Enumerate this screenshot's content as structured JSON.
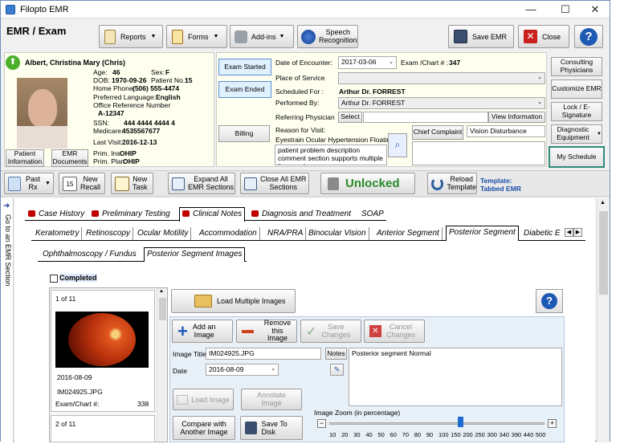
{
  "window": {
    "title": "Filopto EMR",
    "minimize": "—",
    "maximize": "☐",
    "close": "✕"
  },
  "header": {
    "title": "EMR / Exam"
  },
  "toolbar": {
    "reports": "Reports",
    "forms": "Forms",
    "addins": "Add-ins",
    "speech1": "Speech",
    "speech2": "Recognition",
    "save": "Save EMR",
    "close": "Close",
    "help": "?"
  },
  "patient": {
    "name": "Albert, Christina Mary (Chris)",
    "age_l": "Age:",
    "age": "46",
    "sex_l": "Sex:",
    "sex": "F",
    "dob_l": "DOB:",
    "dob": "1970-09-26",
    "pno_l": "Patient No.:",
    "pno": "15",
    "home_l": "Home Phone:",
    "home": "(506) 555-4474",
    "lang_l": "Preferred Language:",
    "lang": "English",
    "ref_l": "Office Reference Number",
    "ref": "A-12347",
    "ssn_l": "SSN:",
    "ssn": "444 4444 4444 4",
    "med_l": "Medicare:",
    "med": "4535567677",
    "last_l": "Last Visit:",
    "last": "2016-12-13",
    "pins_l": "Prim. Ins:",
    "pins": "OHIP",
    "pplan_l": "Prim. Plan:",
    "pplan": "OHIP",
    "info_btn": "Patient Information",
    "docs_btn": "EMR Documents"
  },
  "exam": {
    "started": "Exam Started",
    "ended": "Exam Ended",
    "billing": "Billing",
    "date_l": "Date of Encounter:",
    "date": "2017-03-06",
    "chart_l": "Exam /Chart # :",
    "chart": "347",
    "place_l": "Place of Service",
    "sched_l": "Scheduled For :",
    "sched": "Arthur Dr. FORREST",
    "perf_l": "Performed By:",
    "perf": "Arthur  Dr. FORREST",
    "refphys_l": "Referring Physician",
    "select": "Select",
    "viewinfo": "View Information",
    "reason_l": "Reason for Visit:",
    "reason": "Eyestrain Ocular Hypertension Floatin",
    "chief_btn": "Chief Complaint",
    "chief": "Vision Disturbance",
    "desc": "patient problem description comment section supports multiple lines and"
  },
  "rightbtns": {
    "consult": "Consulting Physicians",
    "custom": "Customize EMR",
    "lock": "Lock / E-Signature",
    "diag": "Diagnostic Equipment",
    "sched": "My Schedule"
  },
  "actions": {
    "pastrx1": "Past",
    "pastrx2": "Rx",
    "recall1": "New",
    "recall2": "Recall",
    "task1": "New",
    "task2": "Task",
    "expand1": "Expand All",
    "expand2": "EMR Sections",
    "collapse1": "Close All EMR",
    "collapse2": "Sections",
    "unlocked": "Unlocked",
    "reload1": "Reload",
    "reload2": "Template",
    "template_l": "Template:",
    "template": "Tabbed EMR"
  },
  "side": {
    "goto": "Go to an EMR Section"
  },
  "tabs": [
    "Case History",
    "Preliminary Testing",
    "Clinical Notes",
    "Diagnosis and Treatment",
    "SOAP"
  ],
  "subtabs": [
    "Keratometry",
    "Retinoscopy",
    "Ocular Motility",
    "Accommodation",
    "NRA/PRA",
    "Binocular Vision",
    "Anterior Segment",
    "Posterior Segment",
    "Diabetic E"
  ],
  "subsubtabs": [
    "Ophthalmoscopy / Fundus",
    "Posterior Segment Images"
  ],
  "content": {
    "completed": "Completed",
    "load_multi": "Load Multiple Images",
    "add1": "Add an",
    "add2": "Image",
    "remove1": "Remove this",
    "remove2": "Image",
    "save1": "Save",
    "save2": "Changes",
    "cancel1": "Cancel",
    "cancel2": "Changes",
    "title_l": "Image Title",
    "title": "IM024925.JPG",
    "date_l": "Date",
    "date": "2016-08-09",
    "notes_btn": "Notes",
    "notes": "Posterior segment Normal",
    "loadimg": "Load Image",
    "annot1": "Annotate",
    "annot2": "Image",
    "compare1": "Compare with",
    "compare2": "Another Image",
    "savedisk": "Save To Disk",
    "zoom_l": "Image Zoom (in percentage)",
    "zoom_ticks": [
      "10",
      "20",
      "30",
      "40",
      "50",
      "60",
      "70",
      "80",
      "90",
      "100",
      "150",
      "200",
      "250",
      "300",
      "340",
      "390",
      "440",
      "500"
    ]
  },
  "thumbs": {
    "count1": "1 of 11",
    "date": "2016-08-09",
    "file": "IM024925.JPG",
    "chart_l": "Exam/Chart #:",
    "chart": "338",
    "count2": "2 of 11"
  }
}
